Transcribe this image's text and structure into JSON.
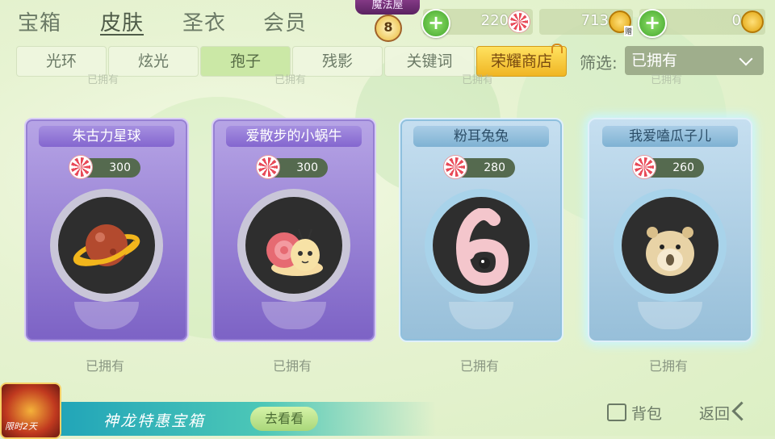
{
  "top_tabs": [
    {
      "label": "宝箱",
      "active": false
    },
    {
      "label": "皮肤",
      "active": true
    },
    {
      "label": "圣衣",
      "active": false
    },
    {
      "label": "会员",
      "active": false
    }
  ],
  "magic_shop": {
    "title": "魔法屋",
    "level": "8"
  },
  "currencies": {
    "candy": "220",
    "coin": "713",
    "coin_badge": "赠",
    "gold": "0"
  },
  "sub_tabs": [
    {
      "label": "光环",
      "active": false
    },
    {
      "label": "炫光",
      "active": false
    },
    {
      "label": "孢子",
      "active": true
    },
    {
      "label": "残影",
      "active": false
    },
    {
      "label": "关键词",
      "active": false
    },
    {
      "label": "荣耀商店",
      "active": false,
      "special": true
    }
  ],
  "filter": {
    "label": "筛选:",
    "value": "已拥有"
  },
  "ghost_owned": [
    "已拥有",
    "已拥有",
    "已拥有",
    "已拥有"
  ],
  "items": [
    {
      "name": "朱古力星球",
      "price": "300",
      "status": "已拥有",
      "rarity": "purple",
      "icon": "planet-icon"
    },
    {
      "name": "爱散步的小蜗牛",
      "price": "300",
      "status": "已拥有",
      "rarity": "purple",
      "icon": "snail-icon"
    },
    {
      "name": "粉耳兔兔",
      "price": "280",
      "status": "已拥有",
      "rarity": "blue",
      "icon": "rabbit-six-icon"
    },
    {
      "name": "我爱嗑瓜子儿",
      "price": "260",
      "status": "已拥有",
      "rarity": "blue",
      "icon": "hamster-icon"
    }
  ],
  "footer": {
    "dragon_label": "限时2天",
    "banner_text": "神龙特惠宝箱",
    "look_button": "去看看",
    "bag_button": "背包",
    "back_button": "返回"
  },
  "colors": {
    "background": "#e7f3d2",
    "accent_green": "#42a52b",
    "purple_card": "#7c62c5",
    "blue_card": "#97bfd9",
    "gold": "#f0b523"
  }
}
